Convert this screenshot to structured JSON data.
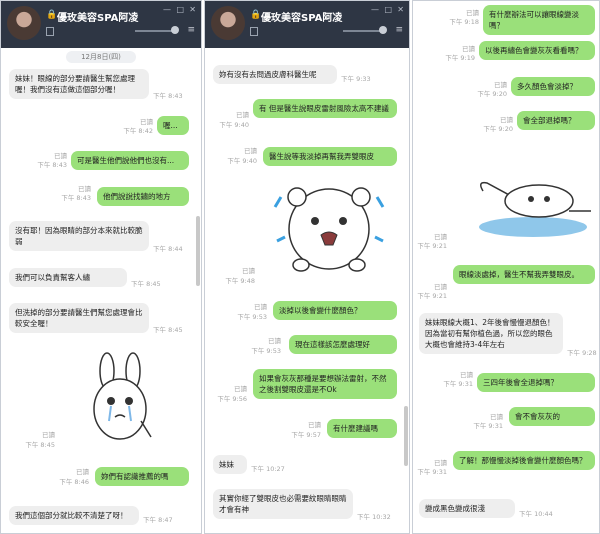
{
  "chat": {
    "title": "優玫美容SPA阿凌"
  },
  "colors": {
    "header": "#2e3644",
    "outgoing_bubble": "#9ae07a",
    "incoming_bubble": "#eeeeee"
  },
  "icons": {
    "lock": "lock-icon",
    "bookmark": "bookmark-icon",
    "menu": "menu-icon",
    "window_controls": "window-control-icons"
  },
  "panel1": {
    "date": "12月8日(四)",
    "m1": {
      "text": "妹妹！眼線的部分要請醫生幫您處理喔！我們沒有這做這個部分喔！",
      "time": "下午 8:43"
    },
    "m2": {
      "read": "已讀",
      "time": "下午 8:42",
      "text": "喔..."
    },
    "m3": {
      "read": "已讀",
      "time": "下午 8:43",
      "text": "可是醫生他們說他們也沒有..."
    },
    "m4": {
      "read": "已讀",
      "time": "下午 8:43",
      "text": "他們說說找鏽的地方"
    },
    "m5": {
      "text": "沒有耶！因為眼睛的部分本來就比較脆弱",
      "time": "下午 8:44"
    },
    "m6": {
      "text": "我們可以負責幫客人繡",
      "time": "下午 8:45"
    },
    "m7": {
      "text": "但洗掉的部分要請醫生們幫您處理會比較安全喔！",
      "time": "下午 8:45"
    },
    "m8": {
      "read": "已讀",
      "time": "下午 8:45"
    },
    "m9": {
      "read": "已讀",
      "time": "下午 8:46",
      "text": "妳們有認識推薦的嗎"
    },
    "m10": {
      "text": "我們這個部分就比較不清楚了呀！",
      "time": "下午 8:47"
    }
  },
  "panel2": {
    "m1": {
      "text": "妳有沒有去問過皮膚科醫生呢",
      "time": "下午 9:33"
    },
    "m2": {
      "read": "已讀",
      "time": "下午 9:40",
      "text": "有 但是醫生說眼皮雷射風險太高不建議"
    },
    "m3": {
      "read": "已讀",
      "time": "下午 9:40",
      "text": "醫生說等我淡掉再幫我弄雙眼皮"
    },
    "m4": {
      "read": "已讀",
      "time": "下午 9:48"
    },
    "m5": {
      "read": "已讀",
      "time": "下午 9:53",
      "text": "淡掉以後會變什麼顏色？"
    },
    "m6": {
      "read": "已讀",
      "time": "下午 9:53",
      "text": "現在這樣該怎麼處理好"
    },
    "m7": {
      "read": "已讀",
      "time": "下午 9:56",
      "text": "如果會灰灰那種是要想辦法雷射，不然之後割雙眼皮還是不Ok"
    },
    "m8": {
      "read": "已讀",
      "time": "下午 9:57",
      "text": "有什麼建議嗎"
    },
    "m9": {
      "text": "妹妹",
      "time": "下午 10:27"
    },
    "m10": {
      "text": "其實你經了雙眼皮也必需要紋眼睛眼睛才會有神",
      "time": "下午 10:32"
    }
  },
  "panel3": {
    "m1": {
      "read": "已讀",
      "time": "下午 9:18",
      "text": "有什麼辦法可以讓眼線變淡嗎？"
    },
    "m2": {
      "read": "已讀",
      "time": "下午 9:19",
      "text": "以後再繡色會變灰灰看看嗎？"
    },
    "m3": {
      "read": "已讀",
      "time": "下午 9:20",
      "text": "多久顏色會淡掉？"
    },
    "m4": {
      "read": "已讀",
      "time": "下午 9:20",
      "text": "會全部退掉嗎？"
    },
    "m5": {
      "read": "已讀",
      "time": "下午 9:21"
    },
    "m6": {
      "read": "已讀",
      "time": "下午 9:21",
      "text": "眼線淡處掉，醫生不幫我弄雙眼皮。"
    },
    "m7": {
      "text": "妹妹眼線大概1、2年後會慢慢退顏色！因為當初有幫你植色過，所以您的眼色大概也會維持3-4年左右",
      "time": "下午 9:28"
    },
    "m8": {
      "read": "已讀",
      "time": "下午 9:31",
      "text": "三四年後會全退掉嗎？"
    },
    "m9": {
      "read": "已讀",
      "time": "下午 9:31",
      "text": "會不會灰灰的"
    },
    "m10": {
      "read": "已讀",
      "time": "下午 9:31",
      "text": "了解！那慢慢淡掉後會變什麼顏色嗎？"
    },
    "m11": {
      "text": "變成黑色變成很淺",
      "time": "下午 10:44"
    }
  }
}
